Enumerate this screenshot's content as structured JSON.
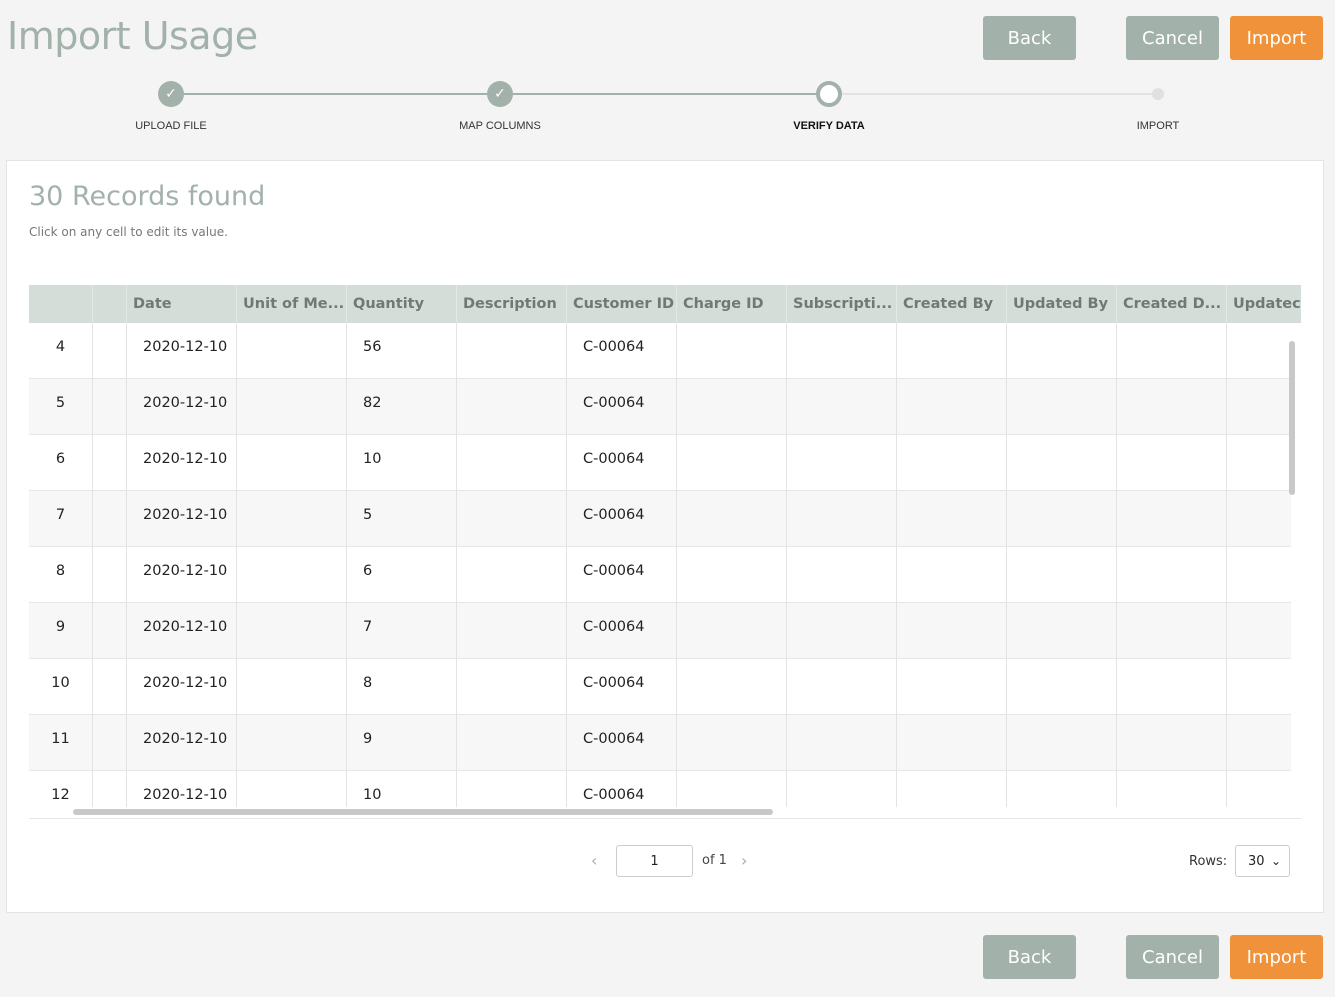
{
  "page": {
    "title": "Import Usage"
  },
  "actions": {
    "back": "Back",
    "cancel": "Cancel",
    "import": "Import"
  },
  "colors": {
    "accent": "#f0923a",
    "muted": "#a3b1ab"
  },
  "stepper": {
    "steps": [
      {
        "label": "UPLOAD FILE",
        "state": "done",
        "icon": "check-icon"
      },
      {
        "label": "MAP COLUMNS",
        "state": "done",
        "icon": "check-icon"
      },
      {
        "label": "VERIFY DATA",
        "state": "current"
      },
      {
        "label": "IMPORT",
        "state": "future"
      }
    ]
  },
  "records": {
    "title": "30 Records found",
    "hint": "Click on any cell to edit its value."
  },
  "grid": {
    "columns": [
      "",
      "",
      "Date",
      "Unit of Me...",
      "Quantity",
      "Description",
      "Customer ID",
      "Charge ID",
      "Subscripti...",
      "Created By",
      "Updated By",
      "Created D...",
      "Updatec"
    ],
    "rows": [
      {
        "num": "4",
        "date": "2020-12-10",
        "qty": "56",
        "cust": "C-00064"
      },
      {
        "num": "5",
        "date": "2020-12-10",
        "qty": "82",
        "cust": "C-00064"
      },
      {
        "num": "6",
        "date": "2020-12-10",
        "qty": "10",
        "cust": "C-00064"
      },
      {
        "num": "7",
        "date": "2020-12-10",
        "qty": "5",
        "cust": "C-00064"
      },
      {
        "num": "8",
        "date": "2020-12-10",
        "qty": "6",
        "cust": "C-00064"
      },
      {
        "num": "9",
        "date": "2020-12-10",
        "qty": "7",
        "cust": "C-00064"
      },
      {
        "num": "10",
        "date": "2020-12-10",
        "qty": "8",
        "cust": "C-00064"
      },
      {
        "num": "11",
        "date": "2020-12-10",
        "qty": "9",
        "cust": "C-00064"
      },
      {
        "num": "12",
        "date": "2020-12-10",
        "qty": "10",
        "cust": "C-00064"
      }
    ]
  },
  "pager": {
    "page": "1",
    "of_label": "of 1",
    "rows_label": "Rows:",
    "rows_value": "30"
  }
}
